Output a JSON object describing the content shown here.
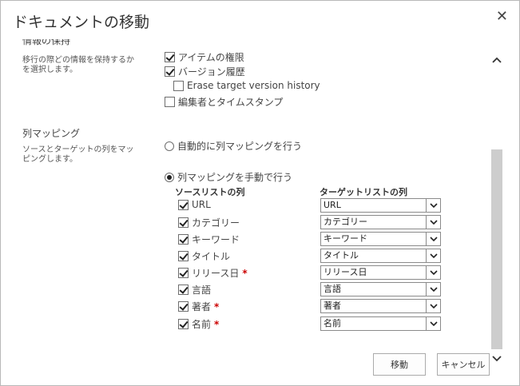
{
  "dialog": {
    "title": "ドキュメントの移動",
    "close_icon": "close-icon"
  },
  "info_section": {
    "title_partial": "情報の保持",
    "description": "移行の際どの情報を保持するかを選択します。",
    "options": [
      {
        "label": "アイテムの権限",
        "checked": true
      },
      {
        "label": "バージョン履歴",
        "checked": true
      },
      {
        "label": "Erase target version history",
        "checked": false
      },
      {
        "label": "編集者とタイムスタンプ",
        "checked": false
      }
    ]
  },
  "mapping_section": {
    "title": "列マッピング",
    "description": "ソースとターゲットの列をマッピングします。",
    "auto_option": {
      "label": "自動的に列マッピングを行う",
      "selected": false
    },
    "manual_option": {
      "label": "列マッピングを手動で行う",
      "selected": true
    },
    "source_header": "ソースリストの列",
    "target_header": "ターゲットリストの列",
    "rows": [
      {
        "source": "URL",
        "required": "",
        "target": "URL",
        "checked": true
      },
      {
        "source": "カテゴリー",
        "required": "",
        "target": "カテゴリー",
        "checked": true
      },
      {
        "source": "キーワード",
        "required": "",
        "target": "キーワード",
        "checked": true
      },
      {
        "source": "タイトル",
        "required": "",
        "target": "タイトル",
        "checked": true
      },
      {
        "source": "リリース日",
        "required": "*",
        "target": "リリース日",
        "checked": true
      },
      {
        "source": "言語",
        "required": "",
        "target": "言語",
        "checked": true
      },
      {
        "source": "著者",
        "required": "*",
        "target": "著者",
        "checked": true
      },
      {
        "source": "名前",
        "required": "*",
        "target": "名前",
        "checked": true
      }
    ]
  },
  "buttons": {
    "move": "移動",
    "cancel": "キャンセル"
  },
  "colors": {
    "required": "#c00000",
    "scroll_thumb": "#cdcdcd",
    "border": "#ababab"
  }
}
